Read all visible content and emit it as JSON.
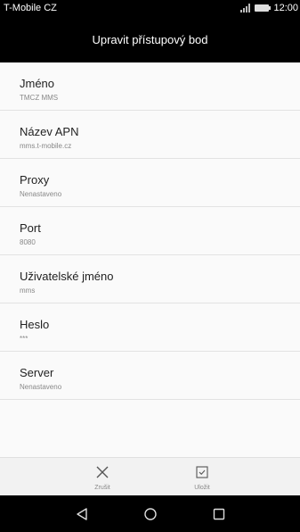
{
  "status_bar": {
    "carrier": "T-Mobile CZ",
    "time": "12:00"
  },
  "header": {
    "title": "Upravit přístupový bod"
  },
  "items": [
    {
      "title": "Jméno",
      "value": "TMCZ MMS"
    },
    {
      "title": "Název APN",
      "value": "mms.t-mobile.cz"
    },
    {
      "title": "Proxy",
      "value": "Nenastaveno"
    },
    {
      "title": "Port",
      "value": "8080"
    },
    {
      "title": "Uživatelské jméno",
      "value": "mms"
    },
    {
      "title": "Heslo",
      "value": "***"
    },
    {
      "title": "Server",
      "value": "Nenastaveno"
    }
  ],
  "actions": {
    "cancel_label": "Zrušit",
    "save_label": "Uložit"
  },
  "icons": {
    "cancel": "close-icon",
    "save": "checkbox-icon",
    "back": "back-triangle-icon",
    "home": "home-circle-icon",
    "recents": "recents-square-icon"
  }
}
